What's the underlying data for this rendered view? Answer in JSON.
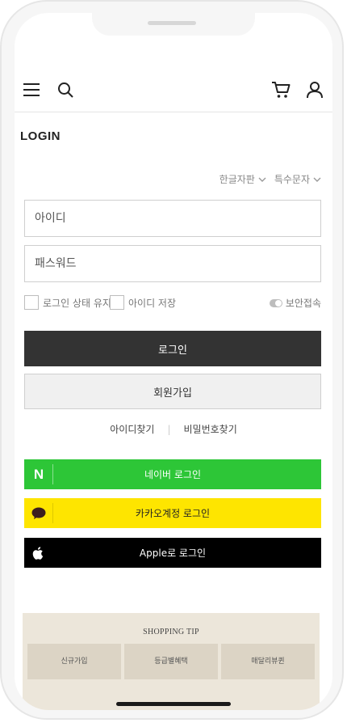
{
  "header": {
    "menu_icon": "hamburger-menu-icon",
    "search_icon": "search-icon",
    "cart_icon": "cart-icon",
    "user_icon": "user-icon"
  },
  "login": {
    "title": "LOGIN",
    "keyboard_options": [
      "한글자판",
      "특수문자"
    ],
    "id_placeholder": "아이디",
    "password_placeholder": "패스워드",
    "keep_login_label": "로그인 상태 유지",
    "save_id_label": "아이디 저장",
    "secure_login_label": "보안접속",
    "login_button": "로그인",
    "join_button": "회원가입",
    "find_id": "아이디찾기",
    "find_password": "비밀번호찾기"
  },
  "social": {
    "naver": "네이버 로그인",
    "naver_logo": "N",
    "kakao": "카카오계정 로그인",
    "apple": "Apple로 로그인"
  },
  "shopping_tip": {
    "title": "SHOPPING TIP",
    "items": [
      "신규가입",
      "등급별혜택",
      "매달리뷰퀸"
    ]
  },
  "colors": {
    "naver": "#2DC637",
    "kakao": "#FEE500",
    "apple": "#000000",
    "login_button": "#333333",
    "tip_background": "#ece6da"
  }
}
